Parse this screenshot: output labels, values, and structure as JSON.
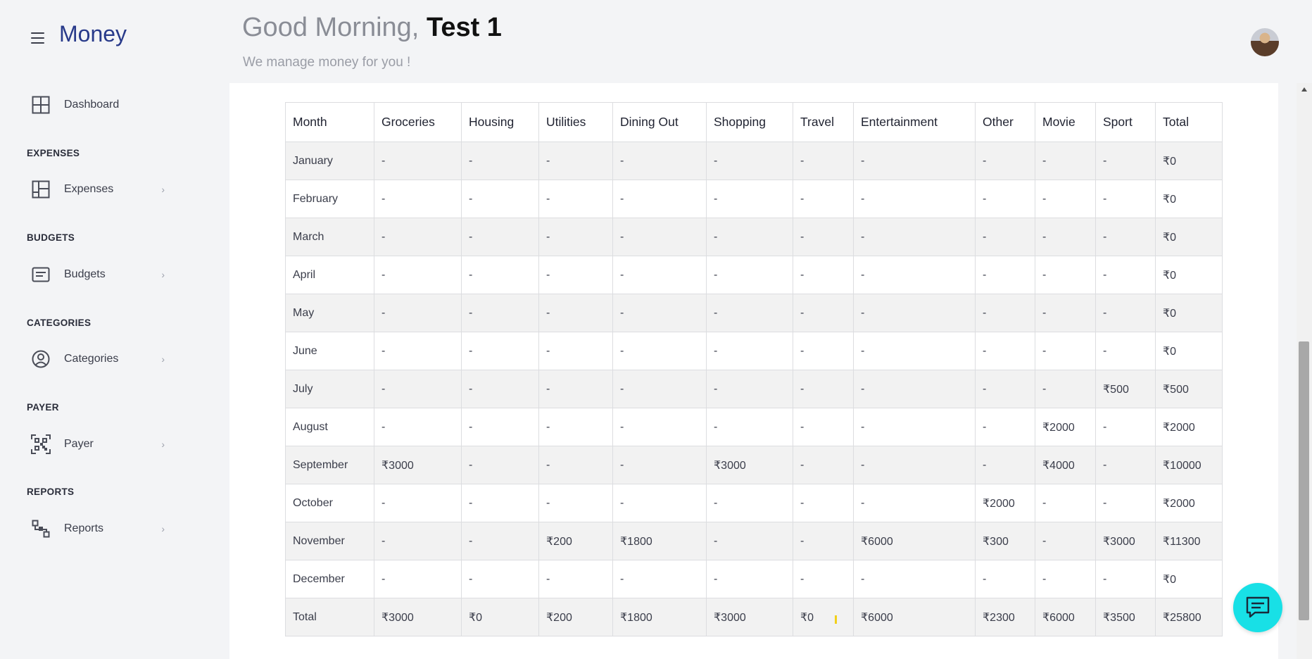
{
  "app": {
    "brand": "Money"
  },
  "header": {
    "greeting_prefix": "Good Morning,",
    "user_name": "Test 1",
    "subtitle": "We manage money for you !"
  },
  "sidebar": {
    "dashboard": "Dashboard",
    "sections": {
      "expenses": {
        "title": "EXPENSES",
        "item": "Expenses"
      },
      "budgets": {
        "title": "BUDGETS",
        "item": "Budgets"
      },
      "categories": {
        "title": "CATEGORIES",
        "item": "Categories"
      },
      "payer": {
        "title": "PAYER",
        "item": "Payer"
      },
      "reports": {
        "title": "REPORTS",
        "item": "Reports"
      }
    }
  },
  "table": {
    "headers": [
      "Month",
      "Groceries",
      "Housing",
      "Utilities",
      "Dining Out",
      "Shopping",
      "Travel",
      "Entertainment",
      "Other",
      "Movie",
      "Sport",
      "Total"
    ],
    "rows": [
      [
        "January",
        "-",
        "-",
        "-",
        "-",
        "-",
        "-",
        "-",
        "-",
        "-",
        "-",
        "₹0"
      ],
      [
        "February",
        "-",
        "-",
        "-",
        "-",
        "-",
        "-",
        "-",
        "-",
        "-",
        "-",
        "₹0"
      ],
      [
        "March",
        "-",
        "-",
        "-",
        "-",
        "-",
        "-",
        "-",
        "-",
        "-",
        "-",
        "₹0"
      ],
      [
        "April",
        "-",
        "-",
        "-",
        "-",
        "-",
        "-",
        "-",
        "-",
        "-",
        "-",
        "₹0"
      ],
      [
        "May",
        "-",
        "-",
        "-",
        "-",
        "-",
        "-",
        "-",
        "-",
        "-",
        "-",
        "₹0"
      ],
      [
        "June",
        "-",
        "-",
        "-",
        "-",
        "-",
        "-",
        "-",
        "-",
        "-",
        "-",
        "₹0"
      ],
      [
        "July",
        "-",
        "-",
        "-",
        "-",
        "-",
        "-",
        "-",
        "-",
        "-",
        "₹500",
        "₹500"
      ],
      [
        "August",
        "-",
        "-",
        "-",
        "-",
        "-",
        "-",
        "-",
        "-",
        "₹2000",
        "-",
        "₹2000"
      ],
      [
        "September",
        "₹3000",
        "-",
        "-",
        "-",
        "₹3000",
        "-",
        "-",
        "-",
        "₹4000",
        "-",
        "₹10000"
      ],
      [
        "October",
        "-",
        "-",
        "-",
        "-",
        "-",
        "-",
        "-",
        "₹2000",
        "-",
        "-",
        "₹2000"
      ],
      [
        "November",
        "-",
        "-",
        "₹200",
        "₹1800",
        "-",
        "-",
        "₹6000",
        "₹300",
        "-",
        "₹3000",
        "₹11300"
      ],
      [
        "December",
        "-",
        "-",
        "-",
        "-",
        "-",
        "-",
        "-",
        "-",
        "-",
        "-",
        "₹0"
      ],
      [
        "Total",
        "₹3000",
        "₹0",
        "₹200",
        "₹1800",
        "₹3000",
        "₹0",
        "₹6000",
        "₹2300",
        "₹6000",
        "₹3500",
        "₹25800"
      ]
    ]
  },
  "colors": {
    "brand": "#283a8a",
    "chat_button": "#18e0e6",
    "row_stripe": "#f2f2f2",
    "background": "#f3f4f6"
  },
  "icons": {
    "menu": "hamburger-icon",
    "dashboard": "grid-icon",
    "expenses": "layout-icon",
    "budgets": "card-icon",
    "categories": "user-circle-icon",
    "payer": "qr-code-icon",
    "reports": "flow-icon",
    "chat": "chat-bubble-icon"
  }
}
